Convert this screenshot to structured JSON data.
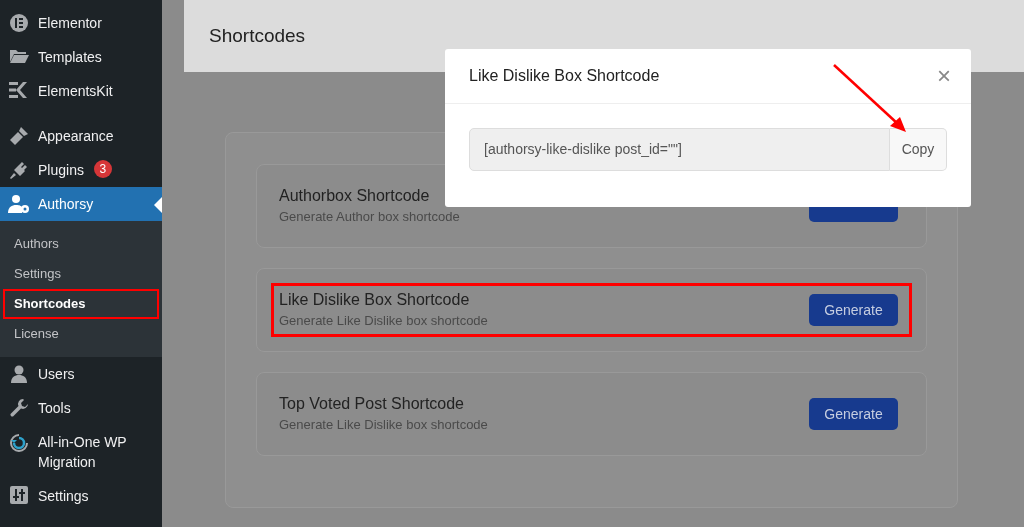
{
  "sidebar": {
    "groups": [
      [
        {
          "label": "Elementor",
          "selected": false
        },
        {
          "label": "Templates",
          "selected": false
        },
        {
          "label": "ElementsKit",
          "selected": false
        }
      ],
      [
        {
          "label": "Appearance",
          "selected": false
        },
        {
          "label": "Plugins",
          "selected": false,
          "badge": "3"
        },
        {
          "label": "Authorsy",
          "selected": true,
          "submenu": [
            {
              "label": "Authors",
              "selected": false,
              "highlighted": false
            },
            {
              "label": "Settings",
              "selected": false,
              "highlighted": false
            },
            {
              "label": "Shortcodes",
              "selected": true,
              "highlighted": true
            },
            {
              "label": "License",
              "selected": false,
              "highlighted": false
            }
          ]
        },
        {
          "label": "Users",
          "selected": false
        },
        {
          "label": "Tools",
          "selected": false
        },
        {
          "label": "All-in-One WP Migration",
          "selected": false
        },
        {
          "label": "Settings",
          "selected": false
        }
      ]
    ]
  },
  "page_title": "Shortcodes",
  "cards": [
    {
      "title": "Authorbox Shortcode",
      "subtitle": "Generate Author box shortcode",
      "highlighted": false
    },
    {
      "title": "Like Dislike Box Shortcode",
      "subtitle": "Generate Like Dislike box shortcode",
      "button": "Generate",
      "highlighted": true
    },
    {
      "title": "Top Voted Post Shortcode",
      "subtitle": "Generate Like Dislike box shortcode",
      "button": "Generate",
      "highlighted": false
    }
  ],
  "modal": {
    "title": "Like Dislike Box Shortcode",
    "close": "×",
    "shortcode": "[authorsy-like-dislike post_id=\"\"]",
    "copy_button": "Copy"
  }
}
